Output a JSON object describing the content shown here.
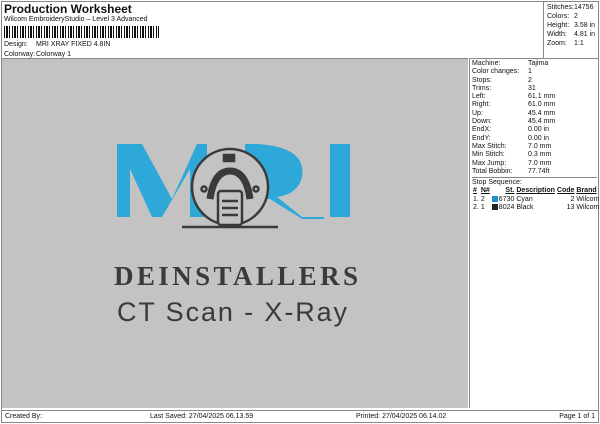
{
  "header": {
    "title": "Production Worksheet",
    "subtitle": "Wilcom EmbroideryStudio – Level 3 Advanced",
    "design_label": "Design:",
    "design": "MRI XRAY FIXED 4.8IN",
    "colorway_label": "Colorway:",
    "colorway": "Colorway 1"
  },
  "summary": [
    {
      "k": "Stitches:",
      "v": "14756"
    },
    {
      "k": "Colors:",
      "v": "2"
    },
    {
      "k": "Height:",
      "v": "3.58 in"
    },
    {
      "k": "Width:",
      "v": "4.81 in"
    },
    {
      "k": "Zoom:",
      "v": "1:1"
    }
  ],
  "details": [
    {
      "k": "Machine:",
      "v": "Tajima"
    },
    {
      "k": "Color changes:",
      "v": "1"
    },
    {
      "k": "Stops:",
      "v": "2"
    },
    {
      "k": "Trims:",
      "v": "31"
    },
    {
      "k": "Left:",
      "v": "61.1 mm"
    },
    {
      "k": "Right:",
      "v": "61.0 mm"
    },
    {
      "k": "Up:",
      "v": "45.4 mm"
    },
    {
      "k": "Down:",
      "v": "45.4 mm"
    },
    {
      "k": "EndX:",
      "v": "0.00 in"
    },
    {
      "k": "EndY:",
      "v": "0.00 in"
    },
    {
      "k": "Max Stitch:",
      "v": "7.0 mm"
    },
    {
      "k": "Min Stitch:",
      "v": "0.3 mm"
    },
    {
      "k": "Max Jump:",
      "v": "7.0 mm"
    },
    {
      "k": "Total Bobbin:",
      "v": "77.74ft"
    }
  ],
  "stops": {
    "title": "Stop Sequence:",
    "headers": [
      "#",
      "N#",
      "St.",
      "Description",
      "Code",
      "Brand"
    ],
    "rows": [
      {
        "n": "1.",
        "nn": "2",
        "color": "#1e90d0",
        "st": "6730",
        "desc": "Cyan",
        "code": "2",
        "brand": "Wilcom"
      },
      {
        "n": "2.",
        "nn": "1",
        "color": "#222222",
        "st": "8024",
        "desc": "Black",
        "code": "13",
        "brand": "Wilcom"
      }
    ]
  },
  "design": {
    "logo": "MRI",
    "line1": "DEINSTALLERS",
    "line2": "CT Scan - X-Ray",
    "cyan": "#2ea8d8",
    "dark": "#3a3a3a"
  },
  "footer": {
    "created": "Created By:",
    "saved": "Last Saved: 27/04/2025 06.13.59",
    "printed": "Printed: 27/04/2025 06.14.02",
    "page": "Page 1 of 1"
  }
}
